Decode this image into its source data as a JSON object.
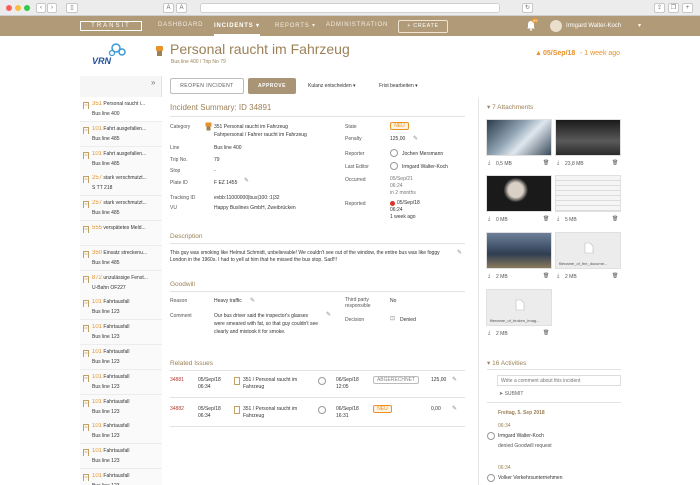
{
  "browser": {
    "reader_label": "A"
  },
  "app": {
    "brand": "TRANSIT",
    "nav": [
      "DASHBOARD",
      "INCIDENTS ▾",
      "REPORTS ▾",
      "ADMINISTRATION"
    ],
    "create": "+ CREATE",
    "user": "Irmgard Walter-Koch",
    "notif_count": "99"
  },
  "header": {
    "logo": "VRN",
    "title": "Personal raucht im Fahrzeug",
    "subtitle": "Bus line 400 / Trip No 79",
    "date": "05/Sep/18",
    "ago": "- 1 week ago"
  },
  "toolbar": {
    "reopen": "REOPEN INCIDENT",
    "approve": "APPROVE",
    "kulanz": "Kulanz entscheiden ▾",
    "frist": "Frist bearbeiten ▾"
  },
  "sidebar": [
    {
      "num": "351",
      "title": "Personal raucht i...",
      "sub": "Bus line 400"
    },
    {
      "num": "101",
      "title": "Fahrt ausgefallen...",
      "sub": "Bus line 485"
    },
    {
      "num": "101",
      "title": "Fahrt ausgefallen...",
      "sub": "Bus line 485"
    },
    {
      "num": "257",
      "title": "stark verschmutzt...",
      "sub": "S TT 218"
    },
    {
      "num": "257",
      "title": "stark verschmutzt...",
      "sub": "Bus line 485"
    },
    {
      "num": "555",
      "title": "verspätetes Meld...",
      "sub": ""
    },
    {
      "num": "350",
      "title": "Einsatz streckenu...",
      "sub": "Bus line 485"
    },
    {
      "num": "872",
      "title": "unzulässige Fenst...",
      "sub": "U-Bahn OF227"
    },
    {
      "num": "101",
      "title": "Fahrtausfall",
      "sub": "Bus line 123"
    },
    {
      "num": "101",
      "title": "Fahrtausfall",
      "sub": "Bus line 123"
    },
    {
      "num": "101",
      "title": "Fahrtausfall",
      "sub": "Bus line 123"
    },
    {
      "num": "101",
      "title": "Fahrtausfall",
      "sub": "Bus line 123"
    },
    {
      "num": "101",
      "title": "Fahrtausfall",
      "sub": "Bus line 123"
    },
    {
      "num": "101",
      "title": "Fahrtausfall",
      "sub": "Bus line 123"
    },
    {
      "num": "101",
      "title": "Fahrtausfall",
      "sub": "Bus line 123"
    },
    {
      "num": "101",
      "title": "Fahrtausfall",
      "sub": "Bus line 123"
    }
  ],
  "summary": {
    "heading": "Incident Summary: ID 34891",
    "left": [
      {
        "k": "Category",
        "v": "351 Personal raucht im Fahrzeug"
      },
      {
        "k": "",
        "v": "Fahrpersonal / Fahrer raucht im Fahrzeug"
      },
      {
        "k": "Line",
        "v": "Bus line 400"
      },
      {
        "k": "Trip No.",
        "v": "79"
      },
      {
        "k": "Stop",
        "v": "-"
      },
      {
        "k": "Plate ID",
        "v": "F EZ 1455"
      },
      {
        "k": "Tracking ID",
        "v": "evbb:11000000|bus|100::1|32"
      },
      {
        "k": "VU",
        "v": "Happy Buslines GmbH, Zweibrücken"
      }
    ],
    "state_label": "State",
    "state": "NEU",
    "penalty_label": "Penalty",
    "penalty": "125,00",
    "reporter_label": "Reporter",
    "reporter": "Jochen Mersmann",
    "editor_label": "Last Editor",
    "editor": "Irmgard Walter-Koch",
    "occurred_label": "Occurred",
    "occurred": [
      "05/Sep/21",
      "06:24",
      "in 2 months"
    ],
    "reported_label": "Reported",
    "reported": [
      "05/Sep/18",
      "06:24",
      "1 week ago"
    ]
  },
  "description": {
    "heading": "Description",
    "text": "This guy was smoking like Helmut Schmidt, unbelievable! We couldn't see out of the window, the entire bus was like foggy London in the 1960s. I had to yell at him that he missed the bus stop. Sad!!!"
  },
  "goodwill": {
    "heading": "Goodwill",
    "reason_label": "Reason",
    "reason": "Heavy traffic",
    "comment_label": "Comment",
    "comment": "Our bus driver said the inspector's glasses were smeared with fat, so that guy couldn't see clearly and mistook it for smoke.",
    "third_label": "Third party responsible",
    "third": "No",
    "decision_label": "Decision",
    "decision": "Denied"
  },
  "related": {
    "heading": "Related Issues",
    "rows": [
      {
        "id": "34881",
        "date": "05/Sep/18",
        "time": "06:34",
        "title": "351 / Personal raucht im Fahrzeug",
        "d2": "06/Sep/18",
        "t2": "12:05",
        "status": "ABGERECHNET",
        "amount": "125,00"
      },
      {
        "id": "34882",
        "date": "05/Sep/18",
        "time": "06:34",
        "title": "351 / Personal raucht im Fahrzeug",
        "d2": "06/Sep/18",
        "t2": "16:31",
        "status": "NEU",
        "amount": "0,00"
      }
    ]
  },
  "attachments": {
    "heading": "7 Attachments",
    "items": [
      {
        "size": "0,5 MB"
      },
      {
        "size": "23,8 MB"
      },
      {
        "size": "0 MB"
      },
      {
        "size": "5 MB"
      },
      {
        "size": "2 MB",
        "name": ""
      },
      {
        "size": "2 MB",
        "name": "filename_of_the_docume..."
      },
      {
        "size": "2 MB",
        "name": "filename_of_broken_imag..."
      }
    ]
  },
  "activities": {
    "heading": "16 Activities",
    "placeholder": "Write a comment about this incident",
    "submit": "SUBMIT",
    "day": "Freitag, 5. Sep 2018",
    "entries": [
      {
        "time": "06:34",
        "who": "Irmgard Walter-Koch",
        "what": "denied Goodwill request"
      },
      {
        "time": "06:34",
        "who": "Volker Verkehrsunternehmen",
        "what": ""
      }
    ]
  },
  "colors": {
    "brand": "#b09a78",
    "accent": "#e6932b",
    "title": "#9c8157"
  }
}
